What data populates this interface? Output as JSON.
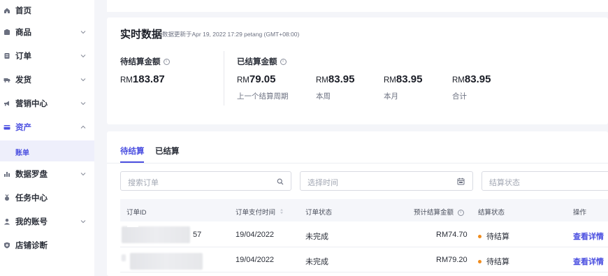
{
  "sidebar": {
    "items": [
      {
        "label": "首页",
        "icon": "home-icon",
        "chevron": false
      },
      {
        "label": "商品",
        "icon": "product-icon",
        "chevron": true
      },
      {
        "label": "订单",
        "icon": "order-icon",
        "chevron": true
      },
      {
        "label": "发货",
        "icon": "shipping-icon",
        "chevron": true
      },
      {
        "label": "营销中心",
        "icon": "megaphone-icon",
        "chevron": true
      },
      {
        "label": "资产",
        "icon": "wallet-icon",
        "chevron": true,
        "expanded": true
      },
      {
        "label": "数据罗盘",
        "icon": "chart-icon",
        "chevron": true
      },
      {
        "label": "任务中心",
        "icon": "medal-icon",
        "chevron": false
      },
      {
        "label": "我的账号",
        "icon": "user-icon",
        "chevron": true
      },
      {
        "label": "店铺诊断",
        "icon": "diagnosis-icon",
        "chevron": false
      }
    ],
    "sub_item": "账单"
  },
  "realtime": {
    "title": "实时数据",
    "updated": "数据更新于Apr 19, 2022 17:29 petang (GMT+08:00)",
    "pending_label": "待结算金额",
    "settled_label": "已结算金额",
    "currency": "RM",
    "pending_amount": "183.87",
    "settled": [
      {
        "amount": "79.05",
        "caption": "上一个结算周期"
      },
      {
        "amount": "83.95",
        "caption": "本周"
      },
      {
        "amount": "83.95",
        "caption": "本月"
      },
      {
        "amount": "83.95",
        "caption": "合计"
      }
    ]
  },
  "tabs": [
    "待结算",
    "已结算"
  ],
  "filters": {
    "search_placeholder": "搜索订单",
    "time_placeholder": "选择时间",
    "status_placeholder": "结算状态"
  },
  "table": {
    "headers": [
      "订单ID",
      "订单支付时间",
      "订单状态",
      "预计结算金额",
      "结算状态",
      "操作"
    ],
    "rows": [
      {
        "order_id_suffix": "57",
        "pay_time": "19/04/2022",
        "order_status": "未完成",
        "amount": "RM74.70",
        "settle_status": "待结算",
        "action": "查看详情"
      },
      {
        "order_id_suffix": "",
        "pay_time": "19/04/2022",
        "order_status": "未完成",
        "amount": "RM79.20",
        "settle_status": "待结算",
        "action": "查看详情"
      }
    ]
  },
  "colors": {
    "accent": "#4b4fe0",
    "pending_dot": "#f08c1d"
  }
}
